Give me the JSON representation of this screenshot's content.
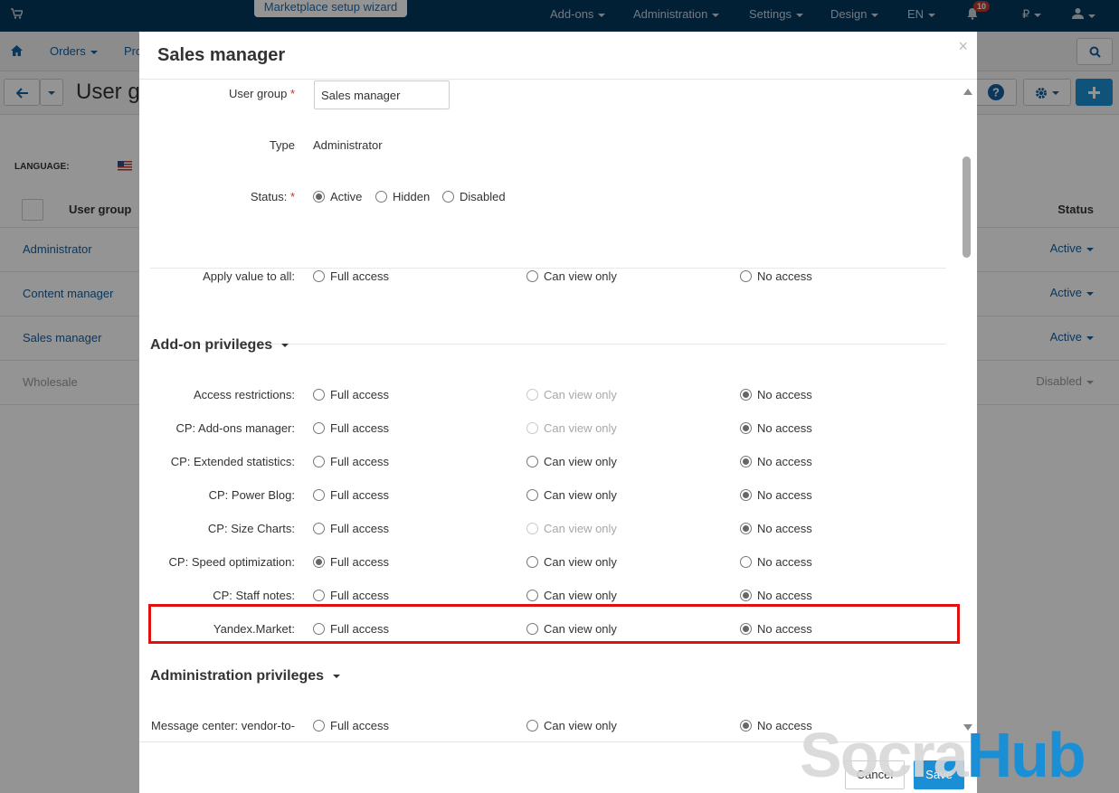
{
  "topbar": {
    "wizard_label": "Marketplace setup wizard",
    "items": [
      "Add-ons",
      "Administration",
      "Settings",
      "Design",
      "EN"
    ],
    "notifications_count": "10",
    "currency": "₽"
  },
  "navbar": {
    "items": [
      "Orders",
      "Pro"
    ]
  },
  "page": {
    "title": "User gr",
    "language_label": "LANGUAGE:",
    "header_user_group": "User group",
    "header_status": "Status",
    "rows": [
      {
        "name": "Administrator",
        "status": "Active"
      },
      {
        "name": "Content manager",
        "status": "Active"
      },
      {
        "name": "Sales manager",
        "status": "Active"
      },
      {
        "name": "Wholesale",
        "status": "Disabled"
      }
    ]
  },
  "modal": {
    "title": "Sales manager",
    "user_group_label": "User group",
    "user_group_value": "Sales manager",
    "type_label": "Type",
    "type_value": "Administrator",
    "status_label": "Status:",
    "status_options": [
      {
        "label": "Active",
        "selected": true
      },
      {
        "label": "Hidden",
        "selected": false
      },
      {
        "label": "Disabled",
        "selected": false
      }
    ],
    "apply_all_label": "Apply value to all:",
    "access_options": [
      "Full access",
      "Can view only",
      "No access"
    ],
    "addon_section_title": "Add-on privileges",
    "addon_rows": [
      {
        "label": "Access restrictions:",
        "selected": 2,
        "view_disabled": true
      },
      {
        "label": "CP: Add-ons manager:",
        "selected": 2,
        "view_disabled": true
      },
      {
        "label": "CP: Extended statistics:",
        "selected": 2,
        "view_disabled": false
      },
      {
        "label": "CP: Power Blog:",
        "selected": 2,
        "view_disabled": false
      },
      {
        "label": "CP: Size Charts:",
        "selected": 2,
        "view_disabled": true
      },
      {
        "label": "CP: Speed optimization:",
        "selected": 0,
        "view_disabled": false
      },
      {
        "label": "CP: Staff notes:",
        "selected": 2,
        "view_disabled": false,
        "highlighted": true
      },
      {
        "label": "Yandex.Market:",
        "selected": 2,
        "view_disabled": false
      }
    ],
    "admin_section_title": "Administration privileges",
    "admin_rows": [
      {
        "label": "Message center: vendor-to-",
        "selected": 2,
        "view_disabled": false
      }
    ],
    "cancel_label": "Cancel",
    "save_label": "Save"
  },
  "watermark": {
    "part1": "Socra",
    "part2": "Hub"
  },
  "colors": {
    "topbar": "#03385c",
    "link": "#145fa0",
    "highlight": "#e31010",
    "primary": "#1a8fd5"
  }
}
